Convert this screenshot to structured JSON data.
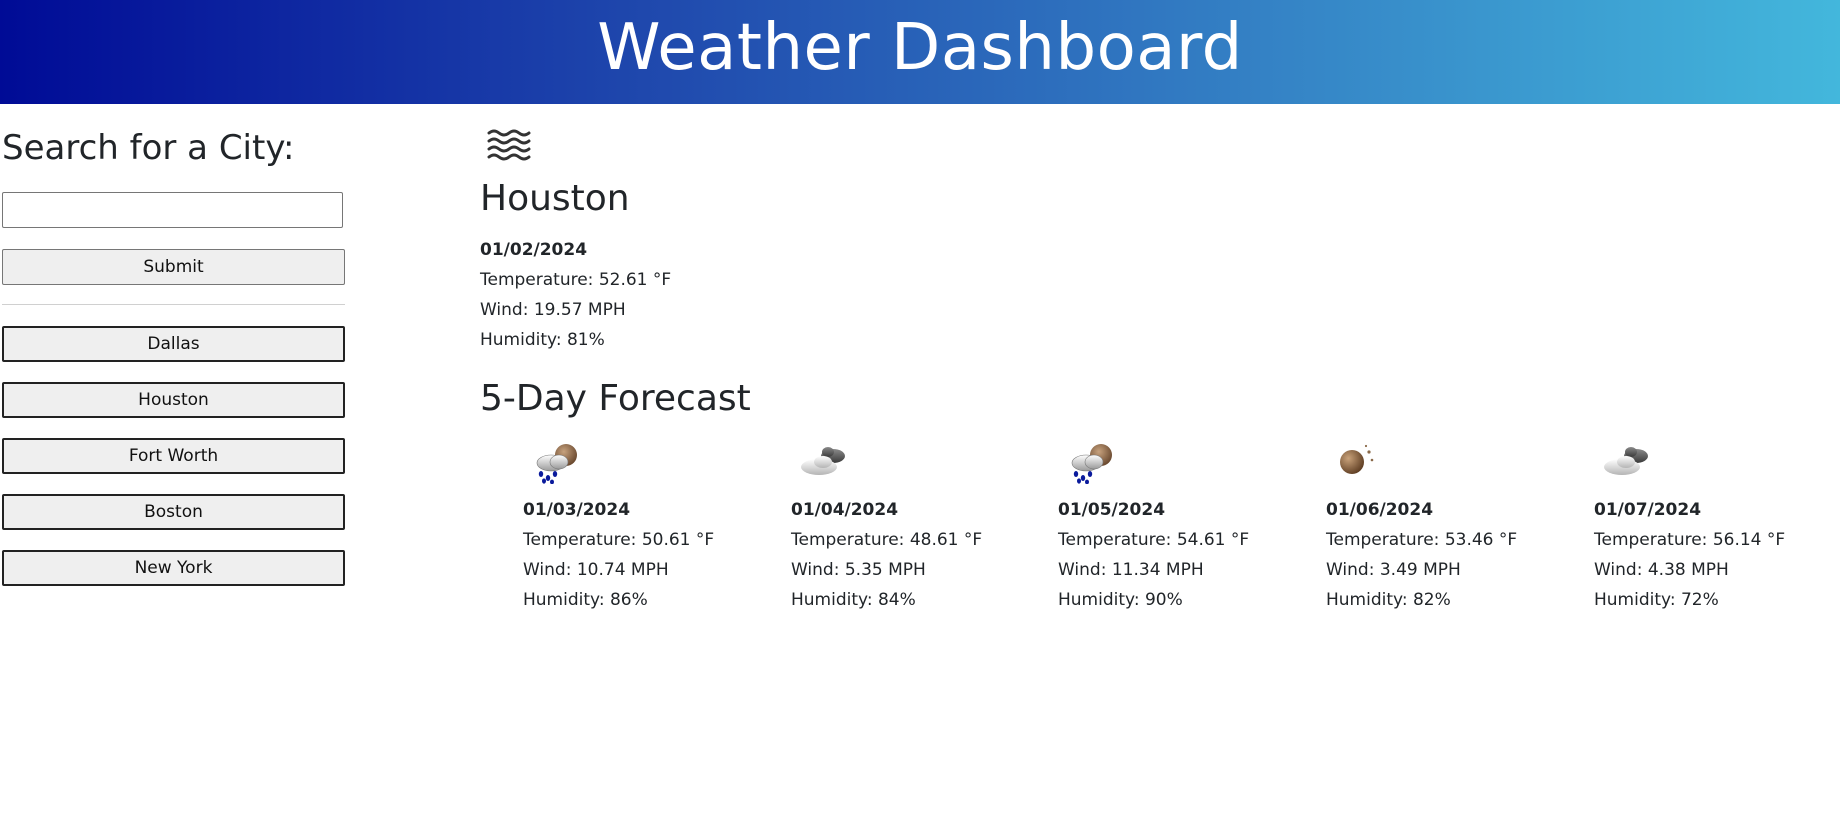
{
  "header": {
    "title": "Weather Dashboard"
  },
  "sidebar": {
    "search_heading": "Search for a City:",
    "search_input": {
      "value": "",
      "placeholder": ""
    },
    "submit_label": "Submit",
    "history": [
      "Dallas",
      "Houston",
      "Fort Worth",
      "Boston",
      "New York"
    ]
  },
  "current": {
    "icon": "mist-icon",
    "city": "Houston",
    "date": "01/02/2024",
    "temperature": "Temperature: 52.61 °F",
    "wind": "Wind: 19.57 MPH",
    "humidity": "Humidity: 81%"
  },
  "forecast": {
    "heading": "5-Day Forecast",
    "days": [
      {
        "icon": "rain-icon",
        "date": "01/03/2024",
        "temperature": "Temperature: 50.61 °F",
        "wind": "Wind: 10.74 MPH",
        "humidity": "Humidity: 86%"
      },
      {
        "icon": "broken-clouds-icon",
        "date": "01/04/2024",
        "temperature": "Temperature: 48.61 °F",
        "wind": "Wind: 5.35 MPH",
        "humidity": "Humidity: 84%"
      },
      {
        "icon": "rain-icon",
        "date": "01/05/2024",
        "temperature": "Temperature: 54.61 °F",
        "wind": "Wind: 11.34 MPH",
        "humidity": "Humidity: 90%"
      },
      {
        "icon": "clear-night-icon",
        "date": "01/06/2024",
        "temperature": "Temperature: 53.46 °F",
        "wind": "Wind: 3.49 MPH",
        "humidity": "Humidity: 82%"
      },
      {
        "icon": "broken-clouds-icon",
        "date": "01/07/2024",
        "temperature": "Temperature: 56.14 °F",
        "wind": "Wind: 4.38 MPH",
        "humidity": "Humidity: 72%"
      }
    ]
  },
  "colors": {
    "header_gradient_start": "#000b96",
    "header_gradient_end": "#43b7dc",
    "button_bg": "#efefef",
    "text": "#212529"
  }
}
